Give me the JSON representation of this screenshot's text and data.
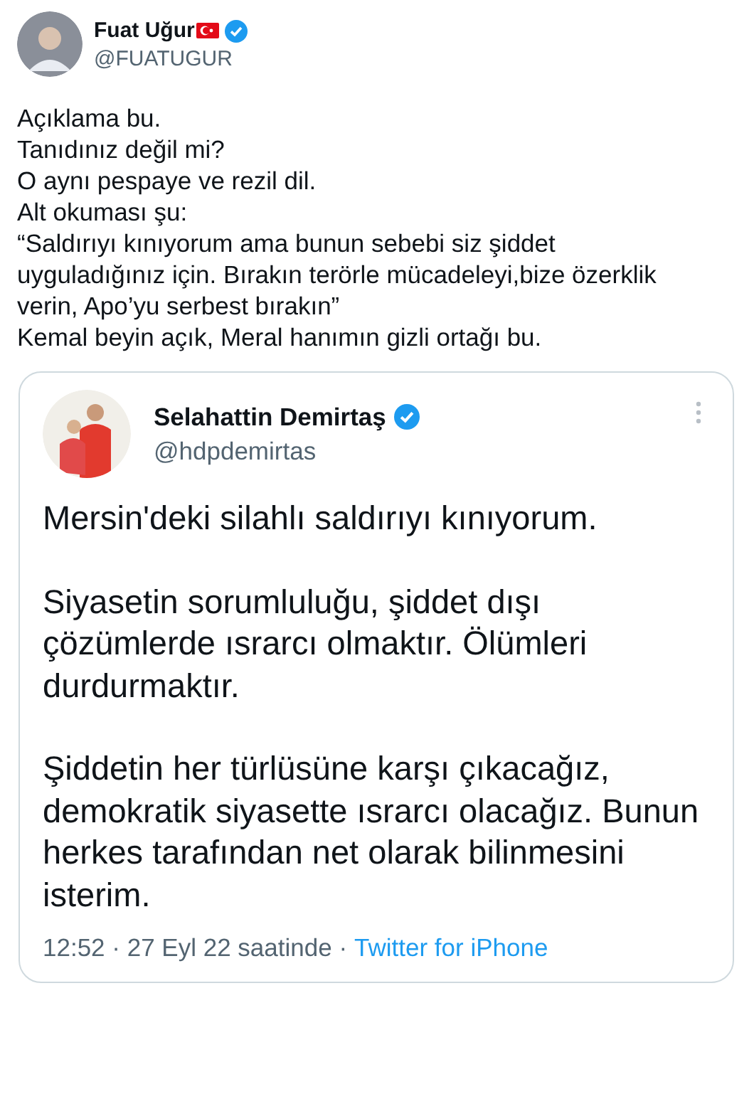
{
  "tweet": {
    "author": {
      "name": "Fuat Uğur",
      "handle": "@FUATUGUR"
    },
    "lines": [
      "Açıklama bu.",
      "Tanıdınız değil mi?",
      "O aynı pespaye ve rezil dil.",
      "Alt okuması şu:",
      "“Saldırıyı kınıyorum ama bunun sebebi siz şiddet uyguladığınız için. Bırakın terörle mücadeleyi,bize özerklik verin, Apo’yu serbest bırakın”",
      "Kemal beyin açık, Meral hanımın gizli ortağı bu."
    ],
    "quoted_tweet": {
      "author": {
        "name": "Selahattin Demirtaş",
        "handle": "@hdpdemirtas"
      },
      "paragraphs": [
        "Mersin'deki silahlı saldırıyı kınıyorum.",
        "Siyasetin sorumluluğu, şiddet dışı çözümlerde ısrarcı olmaktır. Ölümleri durdurmaktır.",
        "Şiddetin her türlüsüne karşı çıkacağız, demokratik siyasette ısrarcı olacağız. Bunun herkes tarafından net olarak bilinmesini isterim."
      ],
      "timestamp": "12:52 · 27 Eyl 22 saatinde ·",
      "source": "Twitter for iPhone"
    }
  }
}
